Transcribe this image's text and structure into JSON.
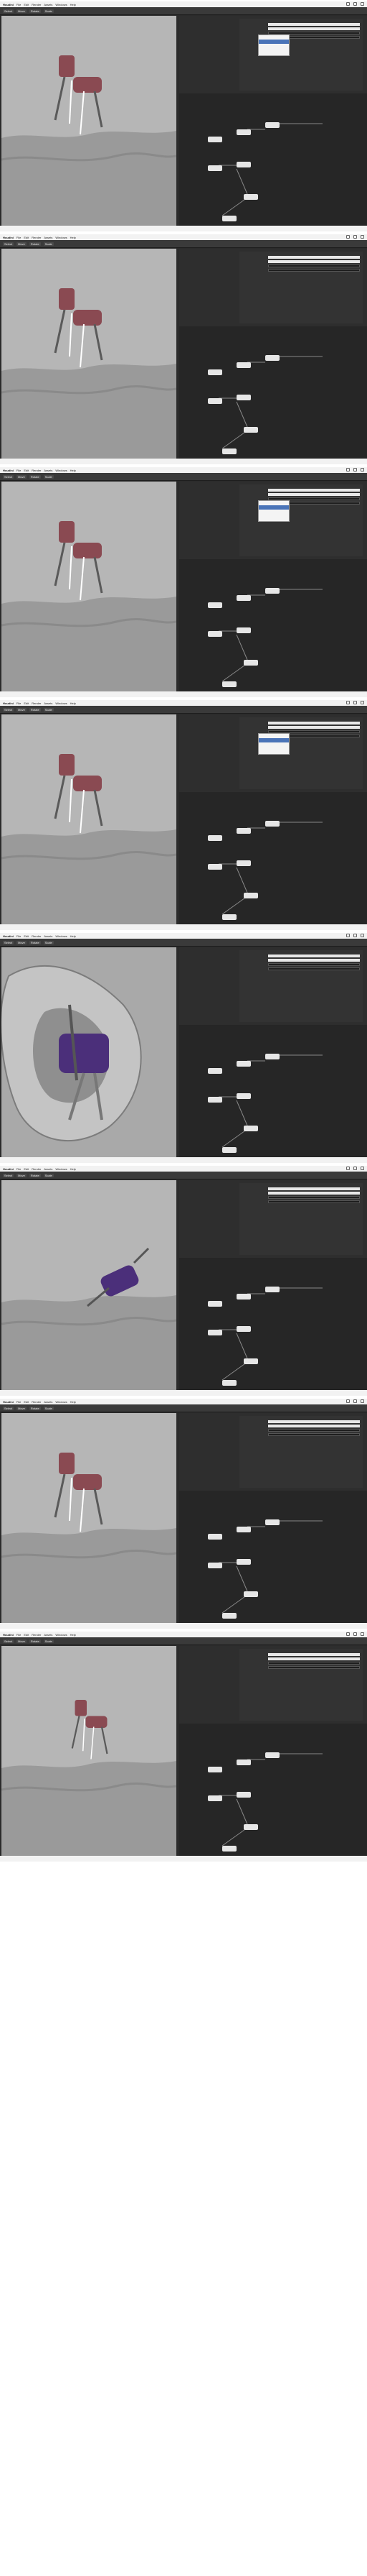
{
  "app": {
    "menu_left": [
      "Houdini",
      "File",
      "Edit",
      "Render",
      "Assets",
      "Windows",
      "Help"
    ],
    "status": "",
    "colors": {
      "viewport_bg": "#b6b6b6",
      "terrain": "#9a9a9a",
      "creature_red": "#8a4a52",
      "creature_purple": "#4b2f7a",
      "panel_bg": "#2e2e2e",
      "node_bg": "#262626",
      "node": "#e6e6e6"
    }
  },
  "frames": [
    {
      "tool_labels": [
        "Select",
        "Move",
        "Rotate",
        "Scale"
      ],
      "variant": "creature-red",
      "popup_open": true
    },
    {
      "tool_labels": [
        "Select",
        "Move",
        "Rotate",
        "Scale"
      ],
      "variant": "creature-red",
      "popup_open": false
    },
    {
      "tool_labels": [
        "Select",
        "Move",
        "Rotate",
        "Scale"
      ],
      "variant": "creature-red",
      "popup_open": true
    },
    {
      "tool_labels": [
        "Select",
        "Move",
        "Rotate",
        "Scale"
      ],
      "variant": "creature-red",
      "popup_open": true
    },
    {
      "tool_labels": [
        "Select",
        "Move",
        "Rotate",
        "Scale"
      ],
      "variant": "closeup-purple",
      "popup_open": false
    },
    {
      "tool_labels": [
        "Select",
        "Move",
        "Rotate",
        "Scale"
      ],
      "variant": "purple-tilted",
      "popup_open": false
    },
    {
      "tool_labels": [
        "Select",
        "Move",
        "Rotate",
        "Scale"
      ],
      "variant": "creature-red",
      "popup_open": false
    },
    {
      "tool_labels": [
        "Select",
        "Move",
        "Rotate",
        "Scale"
      ],
      "variant": "creature-red-small",
      "popup_open": false
    }
  ]
}
